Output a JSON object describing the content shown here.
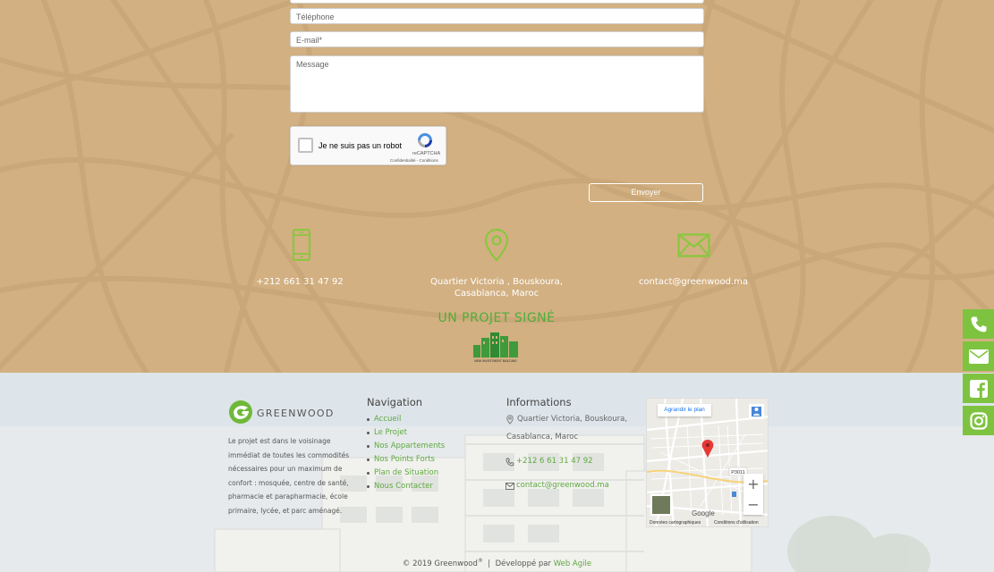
{
  "form": {
    "phone_placeholder": "Téléphone",
    "email_placeholder": "E-mail*",
    "message_placeholder": "Message",
    "recaptcha_label": "Je ne suis pas un robot",
    "recaptcha_brand": "reCAPTCHA",
    "recaptcha_terms": "Confidentialité - Conditions",
    "submit_label": "Envoyer"
  },
  "contact_info": {
    "phone": "+212 661 31 47 92",
    "address_line1": "Quartier Victoria , Bouskoura,",
    "address_line2": "Casablanca, Maroc",
    "email": "contact@greenwood.ma"
  },
  "signed": {
    "title": "UN PROJET SIGNÉ",
    "logo_caption": "NEW INVESTMENT BUILDING"
  },
  "footer": {
    "brand_name": "GREENWOOD",
    "description": "Le projet est dans le voisinage immédiat de toutes les commodités nécessaires pour un maximum de confort : mosquée, centre de santé, pharmacie et parapharmacie, école primaire, lycée, et parc aménagé.",
    "nav_title": "Navigation",
    "nav_items": [
      "Accueil",
      "Le Projet",
      "Nos Appartements",
      "Nos Points Forts",
      "Plan de Situation",
      "Nous Contacter"
    ],
    "info_title": "Informations",
    "info_address_line1": "Quartier Victoria, Bouskoura,",
    "info_address_line2": "Casablanca, Maroc",
    "info_phone": "+212 6 61 31 47 92",
    "info_email": "contact@greenwood.ma",
    "map": {
      "enlarge_label": "Agrandir le plan",
      "road_label": "P3011",
      "google_label": "Google",
      "credit_data": "Données cartographiques",
      "credit_terms": "Conditions d'utilisation"
    },
    "copyright_prefix": "© 2019 Greenwood",
    "copyright_reg": "®",
    "copyright_mid": "  |  Développé par ",
    "copyright_link": "Web Agile"
  },
  "social": [
    "phone-icon",
    "envelope-icon",
    "facebook-icon",
    "instagram-icon"
  ],
  "colors": {
    "tan_background": "#d2b082",
    "brand_green": "#7ec340",
    "link_green": "#5fa83f",
    "icon_green": "#8cc63f"
  }
}
